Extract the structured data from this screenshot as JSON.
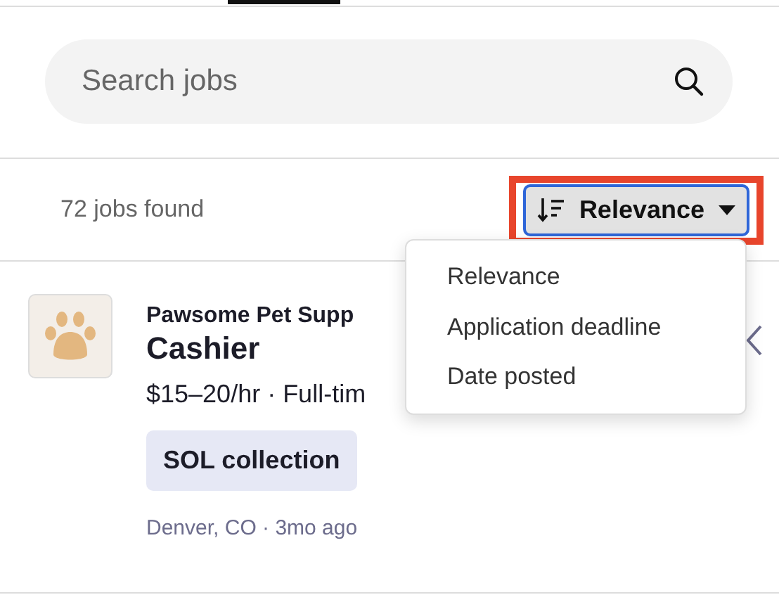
{
  "search": {
    "placeholder": "Search jobs"
  },
  "results": {
    "count": "72 jobs found"
  },
  "sort": {
    "label": "Relevance",
    "highlighted": true,
    "focused": true
  },
  "sort_menu": {
    "open": true,
    "items": [
      {
        "label": "Relevance"
      },
      {
        "label": "Application deadline"
      },
      {
        "label": "Date posted"
      }
    ]
  },
  "jobs": [
    {
      "company": "Pawsome Pet Supp",
      "title": "Cashier",
      "pay": "$15–20/hr · Full-tim",
      "tag": "SOL collection",
      "meta": "Denver, CO · 3mo ago"
    }
  ]
}
